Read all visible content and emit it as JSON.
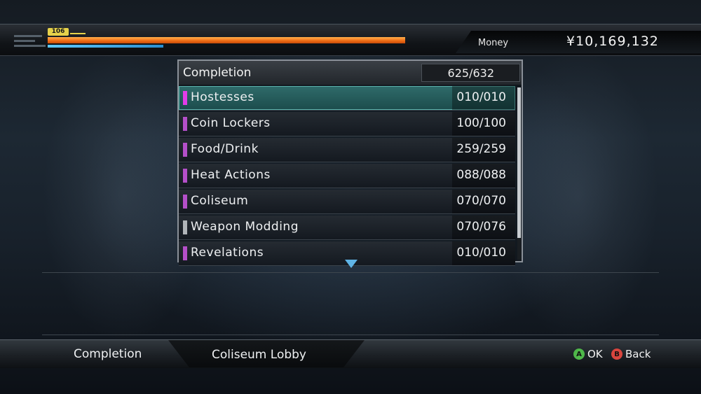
{
  "hud": {
    "level": "106",
    "health_fraction": 1.0,
    "heat_fraction": 0.32,
    "money_label": "Money",
    "money_value": "¥10,169,132"
  },
  "panel": {
    "title": "Completion",
    "total": "625/632",
    "rows": [
      {
        "label": "Hostesses",
        "count": "010/010",
        "marker_color": "#e23ce8",
        "selected": true
      },
      {
        "label": "Coin Lockers",
        "count": "100/100",
        "marker_color": "#b44fc9",
        "selected": false
      },
      {
        "label": "Food/Drink",
        "count": "259/259",
        "marker_color": "#b44fc9",
        "selected": false
      },
      {
        "label": "Heat Actions",
        "count": "088/088",
        "marker_color": "#b44fc9",
        "selected": false
      },
      {
        "label": "Coliseum",
        "count": "070/070",
        "marker_color": "#b44fc9",
        "selected": false
      },
      {
        "label": "Weapon Modding",
        "count": "070/076",
        "marker_color": "#b0b4b8",
        "selected": false
      },
      {
        "label": "Revelations",
        "count": "010/010",
        "marker_color": "#b44fc9",
        "selected": false
      }
    ]
  },
  "footer": {
    "menu_name": "Completion",
    "location": "Coliseum Lobby",
    "ok_button": "A",
    "ok_label": "OK",
    "back_button": "B",
    "back_label": "Back"
  },
  "colors": {
    "health": "#ef6a14",
    "heat": "#5fc9ff",
    "selected_row": "#2f6b6a",
    "scroll_arrow": "#5fb4e6"
  }
}
